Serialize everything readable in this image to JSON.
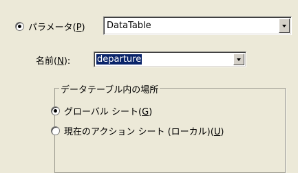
{
  "parameter": {
    "radio_label_text": "パラメータ(",
    "radio_label_key": "P",
    "radio_label_close": ")",
    "selected": true,
    "combo_value": "DataTable"
  },
  "name_field": {
    "label_text": "名前(",
    "label_key": "N",
    "label_close": "):",
    "combo_value": "departure"
  },
  "location_group": {
    "title": "データテーブル内の場所",
    "options": [
      {
        "label_text": "グローバル シート(",
        "label_key": "G",
        "label_close": ")",
        "selected": true
      },
      {
        "label_text": "現在のアクション シート (ローカル)(",
        "label_key": "U",
        "label_close": ")",
        "selected": false
      }
    ]
  }
}
